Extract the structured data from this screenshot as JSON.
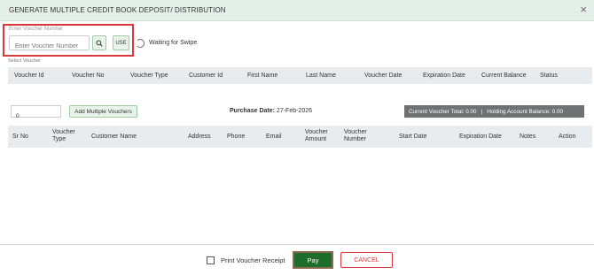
{
  "header": {
    "title": "GENERATE MULTIPLE CREDIT BOOK DEPOSIT/ DISTRIBUTION",
    "close_glyph": "×"
  },
  "voucher": {
    "label": "Enter Voucher Number",
    "placeholder": "Enter Voucher Number",
    "value": "",
    "search_icon": "search-icon",
    "use_label": "USE",
    "swipe_label": "Waiting for Swipe"
  },
  "select_voucher": {
    "label": "Select Voucher",
    "columns": [
      "Voucher Id",
      "Voucher No",
      "Voucher Type",
      "Customer Id",
      "First Name",
      "Last Name",
      "Voucher Date",
      "Expiration Date",
      "Current Balance",
      "Status"
    ]
  },
  "actions": {
    "quantity_value": "0",
    "add_label": "Add Multiple Vouchers",
    "purchase_label": "Purchase Date:",
    "purchase_date": "27-Feb-2026",
    "current_total": "Current Voucher Total: 0.00",
    "separator": "|",
    "holding_balance": "Holding Account Balance: 0.00"
  },
  "detail_table": {
    "columns": [
      "Sr No",
      "Voucher Type",
      "Customer Name",
      "Address",
      "Phone",
      "Email",
      "Voucher Amount",
      "Voucher Number",
      "Start Date",
      "Expiration Date",
      "Notes",
      "Action"
    ]
  },
  "footer": {
    "print_label": "Print Voucher Receipt",
    "pay_label": "Pay",
    "cancel_label": "CANCEL"
  },
  "colors": {
    "header_bg": "#e5efe9",
    "highlight_red": "#d9383e",
    "pay_green": "#1e6d2c",
    "totals_bg": "#6f7173"
  }
}
